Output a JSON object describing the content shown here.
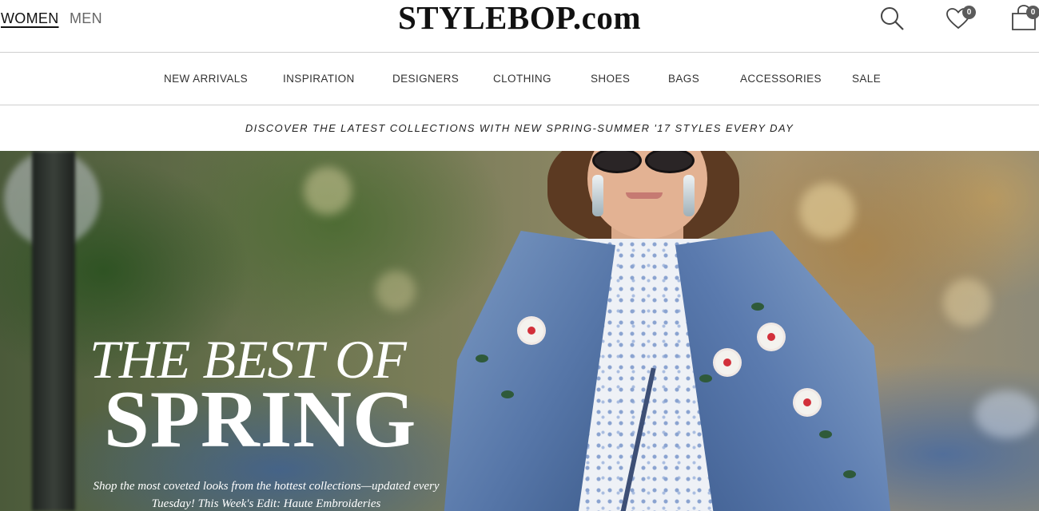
{
  "header": {
    "gender_tabs": [
      {
        "label": "WOMEN",
        "active": true
      },
      {
        "label": "MEN",
        "active": false
      }
    ],
    "logo": "STYLEBOP.com",
    "icons": {
      "search": "search-icon",
      "wishlist": "heart-icon",
      "cart": "shopping-bag-icon"
    },
    "wishlist_count": "0",
    "cart_count": "0"
  },
  "nav": {
    "items": [
      "NEW ARRIVALS",
      "INSPIRATION",
      "DESIGNERS",
      "CLOTHING",
      "SHOES",
      "BAGS",
      "ACCESSORIES",
      "SALE"
    ]
  },
  "promo": {
    "text": "DISCOVER THE LATEST COLLECTIONS WITH NEW SPRING-SUMMER '17 STYLES EVERY DAY"
  },
  "hero": {
    "title_line1": "THE BEST OF",
    "title_line2": "SPRING",
    "subtitle": "Shop the most coveted looks from the hottest collections—updated every Tuesday! This Week's Edit: Haute Embroideries"
  },
  "colors": {
    "text": "#222222",
    "divider": "#cfcfcf",
    "badge": "#5b5b5b",
    "denim": "#5676a8"
  }
}
